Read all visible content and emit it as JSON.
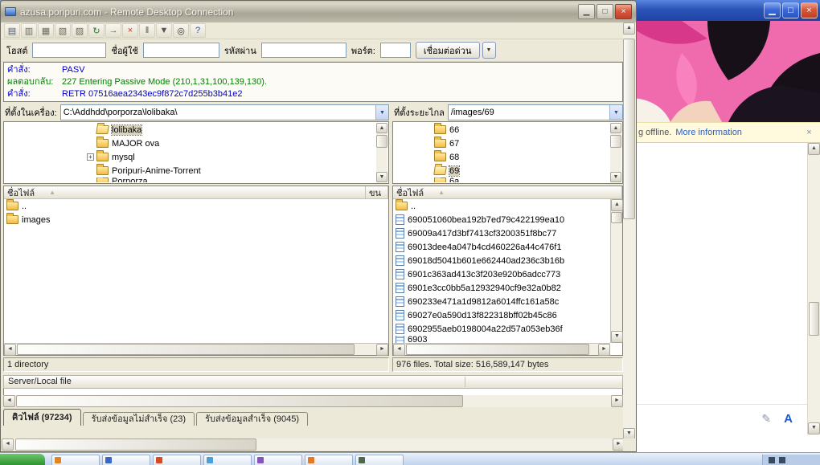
{
  "rdp_window": {
    "title": "azusa.poripuri.com - Remote Desktop Connection",
    "controls": {
      "minimize": "▁",
      "maximize": "□",
      "close": "×"
    }
  },
  "ftp": {
    "toolbar_icons": [
      {
        "name": "site-manager-icon",
        "glyph": "▤",
        "color": "#4a5a78"
      },
      {
        "name": "toggle-log-icon",
        "glyph": "▥",
        "color": "#6a6a5a"
      },
      {
        "name": "toggle-local-tree-icon",
        "glyph": "▦",
        "color": "#6a6a5a"
      },
      {
        "name": "toggle-remote-tree-icon",
        "glyph": "▧",
        "color": "#6a6a5a"
      },
      {
        "name": "toggle-queue-icon",
        "glyph": "▨",
        "color": "#6a6a5a"
      },
      {
        "name": "refresh-icon",
        "glyph": "↻",
        "color": "#2a7a2a"
      },
      {
        "name": "process-queue-icon",
        "glyph": "→",
        "color": "#2a7a2a"
      },
      {
        "name": "cancel-icon",
        "glyph": "×",
        "color": "#c23a22"
      },
      {
        "name": "disconnect-icon",
        "glyph": "‖",
        "color": "#555555"
      },
      {
        "name": "filter-icon",
        "glyph": "▼",
        "color": "#555555"
      },
      {
        "name": "find-icon",
        "glyph": "◎",
        "color": "#333333"
      },
      {
        "name": "help-icon",
        "glyph": "?",
        "color": "#2a50a0"
      }
    ],
    "quickconnect": {
      "host_label": "โฮสต์",
      "host_value": "",
      "user_label": "ชื่อผู้ใช้",
      "user_value": "",
      "pass_label": "รหัสผ่าน",
      "pass_value": "",
      "port_label": "พอร์ต:",
      "port_value": "",
      "button": "เชื่อมต่อด่วน",
      "dropdown_glyph": "▼"
    },
    "log": [
      {
        "label": "คำสั่ง:",
        "text": "PASV",
        "color": "#0000c8"
      },
      {
        "label": "ผลตอบกลับ:",
        "text": "227 Entering Passive Mode (210,1,31,100,139,130).",
        "color": "#008000"
      },
      {
        "label": "คำสั่ง:",
        "text": "RETR 07516aea2343ec9f872c7d255b3b41e2",
        "color": "#0000c8"
      }
    ],
    "local": {
      "label": "ที่ตั้งในเครื่อง:",
      "path": "C:\\Addhdd\\porporza\\lolibaka\\",
      "tree": [
        {
          "label": "lolibaka",
          "icon": "folder-open",
          "indent": 6,
          "selected": true
        },
        {
          "label": "MAJOR ova",
          "icon": "folder",
          "indent": 6
        },
        {
          "label": "mysql",
          "icon": "folder",
          "indent": 6,
          "plus": true
        },
        {
          "label": "Poripuri-Anime-Torrent",
          "icon": "folder",
          "indent": 6
        },
        {
          "label": "Porporza",
          "icon": "folder",
          "indent": 6,
          "clipped": true
        }
      ],
      "header_name": "ชื่อไฟล์",
      "header_size": "ขน",
      "files": [
        {
          "label": "..",
          "icon": "folder"
        },
        {
          "label": "images",
          "icon": "folder"
        }
      ],
      "status": "1 directory"
    },
    "remote": {
      "label": "ที่ตั้งระยะไกล",
      "path": "/images/69",
      "tree": [
        {
          "label": "66",
          "icon": "folder",
          "indent": 2
        },
        {
          "label": "67",
          "icon": "folder",
          "indent": 2
        },
        {
          "label": "68",
          "icon": "folder",
          "indent": 2
        },
        {
          "label": "69",
          "icon": "folder-open",
          "indent": 2,
          "selected": true
        },
        {
          "label": "6a",
          "icon": "folder",
          "indent": 2,
          "clipped": true
        }
      ],
      "header_name": "ชื่อไฟล์",
      "files": [
        {
          "label": "..",
          "icon": "folder"
        },
        {
          "label": "690051060bea192b7ed79c422199ea10",
          "icon": "file"
        },
        {
          "label": "69009a417d3bf7413cf3200351f8bc77",
          "icon": "file"
        },
        {
          "label": "69013dee4a047b4cd460226a44c476f1",
          "icon": "file"
        },
        {
          "label": "69018d5041b601e662440ad236c3b16b",
          "icon": "file"
        },
        {
          "label": "6901c363ad413c3f203e920b6adcc773",
          "icon": "file"
        },
        {
          "label": "6901e3cc0bb5a12932940cf9e32a0b82",
          "icon": "file"
        },
        {
          "label": "690233e471a1d9812a6014ffc161a58c",
          "icon": "file"
        },
        {
          "label": "69027e0a590d13f822318bff02b45c86",
          "icon": "file"
        },
        {
          "label": "6902955aeb0198004a22d57a053eb36f",
          "icon": "file"
        },
        {
          "label": "6903",
          "icon": "file",
          "clipped": true
        }
      ],
      "status": "976 files. Total size: 516,589,147 bytes"
    },
    "queue": {
      "header": "Server/Local file",
      "tabs": [
        {
          "label": "คิวไฟล์ (97234)",
          "selected": true
        },
        {
          "label": "รับส่งข้อมูลไม่สำเร็จ (23)"
        },
        {
          "label": "รับส่งข้อมูลสำเร็จ (9045)"
        }
      ]
    }
  },
  "background_window": {
    "controls": {
      "minimize": "▁",
      "maximize": "□",
      "close": "×"
    },
    "notification": {
      "text": "g offline.",
      "link": "More information",
      "close": "×"
    },
    "composer_icons": [
      {
        "name": "handwriting-mode-icon",
        "glyph": "✎"
      },
      {
        "name": "text-mode-icon",
        "glyph": "A"
      }
    ]
  },
  "taskbar": {
    "buttons": [
      {
        "color": "#e08426"
      },
      {
        "color": "#3a66c8"
      },
      {
        "color": "#d84a20"
      },
      {
        "color": "#4aa0d8"
      },
      {
        "color": "#8a52c0"
      },
      {
        "color": "#e07a26"
      },
      {
        "color": "#4a6a4a"
      }
    ]
  },
  "colors": {
    "command_blue": "#0000c8",
    "response_green": "#008000",
    "link_blue": "#2a5fc4",
    "close_red": "#c23c20",
    "notification_yellow": "#fffade"
  }
}
